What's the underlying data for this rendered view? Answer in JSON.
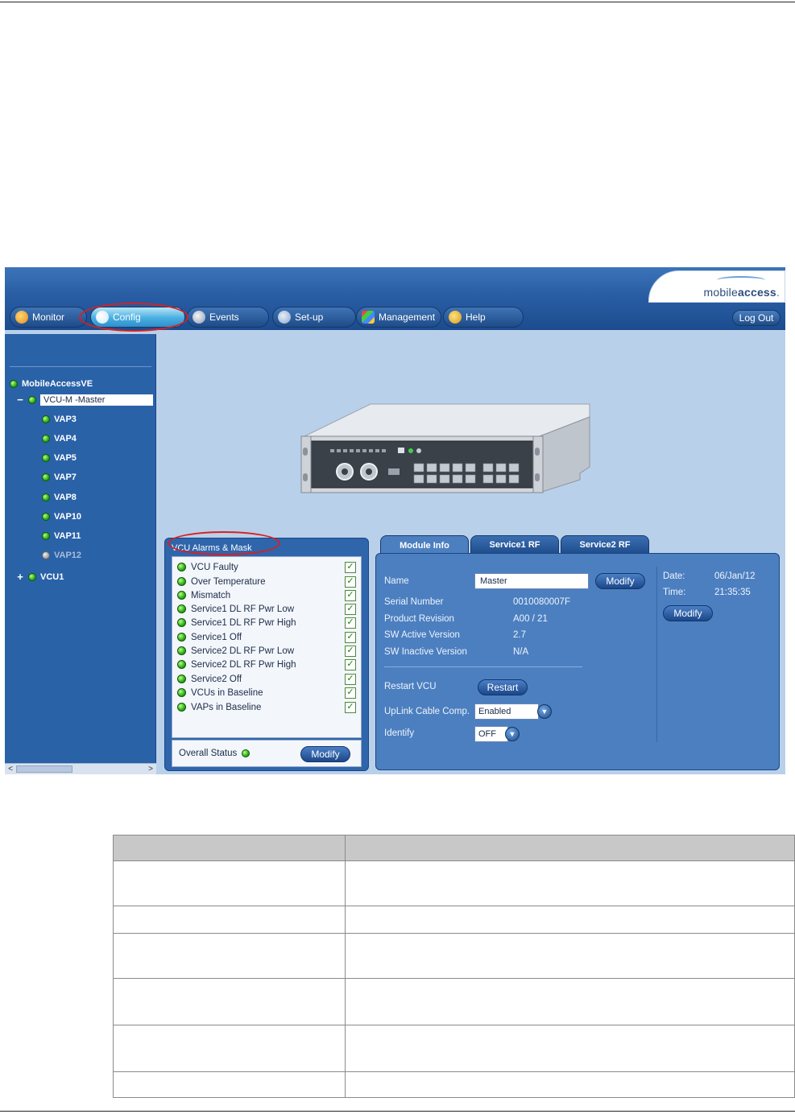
{
  "brand": {
    "logo_left": "mobile",
    "logo_right": "access",
    "logo_dot": "."
  },
  "nav": {
    "tabs": [
      {
        "label": "Monitor",
        "icon": "monitor-icon"
      },
      {
        "label": "Config",
        "icon": "wrench-icon",
        "active": true
      },
      {
        "label": "Events",
        "icon": "events-icon"
      },
      {
        "label": "Set-up",
        "icon": "tools-icon"
      },
      {
        "label": "Management",
        "icon": "management-icon"
      },
      {
        "label": "Help",
        "icon": "help-icon"
      }
    ],
    "logout_label": "Log Out"
  },
  "tree": {
    "root": "MobileAccessVE",
    "nodes": [
      {
        "label": "VCU-M -Master",
        "expander": "−",
        "selected": true
      },
      {
        "label": "VAP3"
      },
      {
        "label": "VAP4"
      },
      {
        "label": "VAP5"
      },
      {
        "label": "VAP7"
      },
      {
        "label": "VAP8"
      },
      {
        "label": "VAP10"
      },
      {
        "label": "VAP11"
      },
      {
        "label": "VAP12",
        "status": "gray"
      },
      {
        "label": "VCU1",
        "expander": "+"
      }
    ],
    "scroll_left": "<",
    "scroll_right": ">"
  },
  "alarms": {
    "title": "VCU Alarms & Mask",
    "items": [
      {
        "label": "VCU Faulty",
        "checked": "✓"
      },
      {
        "label": "Over Temperature",
        "checked": "✓"
      },
      {
        "label": "Mismatch",
        "checked": "✓"
      },
      {
        "label": "Service1 DL RF Pwr Low",
        "checked": "✓"
      },
      {
        "label": "Service1 DL RF Pwr High",
        "checked": "✓"
      },
      {
        "label": "Service1 Off",
        "checked": "✓"
      },
      {
        "label": "Service2 DL RF Pwr Low",
        "checked": "✓"
      },
      {
        "label": "Service2 DL RF Pwr High",
        "checked": "✓"
      },
      {
        "label": "Service2 Off",
        "checked": "✓"
      },
      {
        "label": "VCUs in Baseline",
        "checked": "✓"
      },
      {
        "label": "VAPs in Baseline",
        "checked": "✓"
      }
    ],
    "overall_label": "Overall Status",
    "modify_label": "Modify"
  },
  "module": {
    "tabs": [
      "Module Info",
      "Service1 RF",
      "Service2 RF"
    ],
    "name_label": "Name",
    "name_value": "Master",
    "name_modify": "Modify",
    "fields": [
      {
        "label": "Serial Number",
        "value": "0010080007F"
      },
      {
        "label": "Product Revision",
        "value": "A00 / 21"
      },
      {
        "label": "SW Active Version",
        "value": "2.7"
      },
      {
        "label": "SW Inactive Version",
        "value": "N/A"
      }
    ],
    "restart_label": "Restart VCU",
    "restart_button": "Restart",
    "uplink_label": "UpLink Cable Comp.",
    "uplink_value": "Enabled",
    "identify_label": "Identify",
    "identify_value": "OFF",
    "date_label": "Date:",
    "date_value": "06/Jan/12",
    "time_label": "Time:",
    "time_value": "21:35:35",
    "datetime_modify": "Modify"
  },
  "colors": {
    "header": "#2a5fa6",
    "sidebar": "#2a62a8",
    "led_green": "#2eaa17",
    "highlight_oval": "#d82020"
  }
}
